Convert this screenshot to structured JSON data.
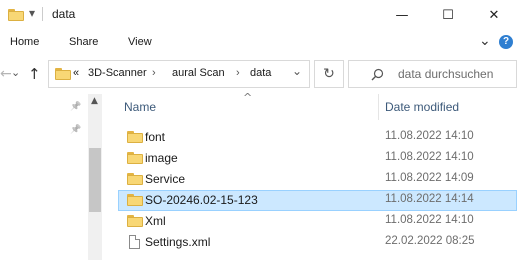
{
  "window": {
    "title": "data",
    "quick_access_arrow": "▾",
    "minimize": "—",
    "maximize": "☐",
    "close": "✕"
  },
  "ribbon": {
    "tabs": [
      "Home",
      "Share",
      "View"
    ],
    "expand_glyph": "⌄",
    "help_glyph": "?"
  },
  "nav": {
    "back": "←",
    "forward": "→",
    "recent": "⌄",
    "up": "↑"
  },
  "address": {
    "overflow": "«",
    "crumbs": [
      "3D-Scanner",
      "aural Scan",
      "data"
    ],
    "separator": "›",
    "dropdown": "⌄",
    "refresh": "↻"
  },
  "search": {
    "placeholder": "data durchsuchen"
  },
  "columns": {
    "name": "Name",
    "date_modified": "Date modified",
    "sort_glyph": "^"
  },
  "pins": [
    "📌",
    "📌"
  ],
  "files": [
    {
      "name": "font",
      "date": "11.08.2022 14:10",
      "type": "folder",
      "selected": false
    },
    {
      "name": "image",
      "date": "11.08.2022 14:10",
      "type": "folder",
      "selected": false
    },
    {
      "name": "Service",
      "date": "11.08.2022 14:09",
      "type": "folder",
      "selected": false
    },
    {
      "name": "SO-20246.02-15-123",
      "date": "11.08.2022 14:14",
      "type": "folder",
      "selected": true
    },
    {
      "name": "Xml",
      "date": "11.08.2022 14:10",
      "type": "folder",
      "selected": false
    },
    {
      "name": "Settings.xml",
      "date": "22.02.2022 08:25",
      "type": "file",
      "selected": false
    }
  ],
  "colors": {
    "selection_bg": "#cce8ff",
    "selection_border": "#99d1ff",
    "folder": "#f8d775"
  }
}
